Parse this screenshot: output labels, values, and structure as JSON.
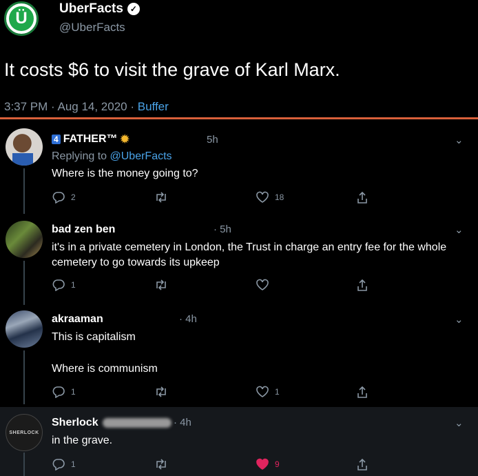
{
  "tweet": {
    "display_name": "UberFacts",
    "handle": "@UberFacts",
    "text": "It costs $6 to visit the grave of Karl Marx.",
    "time": "3:37 PM · Aug 14, 2020 · ",
    "source": "Buffer",
    "logo_letter": "Ü"
  },
  "replies": [
    {
      "name": "FATHER™",
      "badge": "4",
      "time": "5h",
      "replying_prefix": "Replying to ",
      "replying_handle": "@UberFacts",
      "text": "Where is the money going to?",
      "reply_count": "2",
      "retweet_count": "",
      "like_count": "18"
    },
    {
      "name": "bad zen ben",
      "time": "· 5h",
      "text": "it's in a private cemetery in London, the Trust in charge an entry fee for the whole cemetery to go towards its upkeep",
      "reply_count": "1",
      "retweet_count": "",
      "like_count": ""
    },
    {
      "name": "akraaman",
      "time": "· 4h",
      "text": "This is capitalism",
      "text2": "Where is communism",
      "reply_count": "1",
      "retweet_count": "",
      "like_count": "1"
    },
    {
      "name": "Sherlock",
      "time": "· 4h",
      "text": "in the grave.",
      "reply_count": "1",
      "retweet_count": "",
      "like_count": "9",
      "avatar_label": "SHERLOCK"
    }
  ],
  "colors": {
    "accent_link": "#4aa3e8",
    "divider": "#d9603a",
    "liked": "#e0245e"
  }
}
